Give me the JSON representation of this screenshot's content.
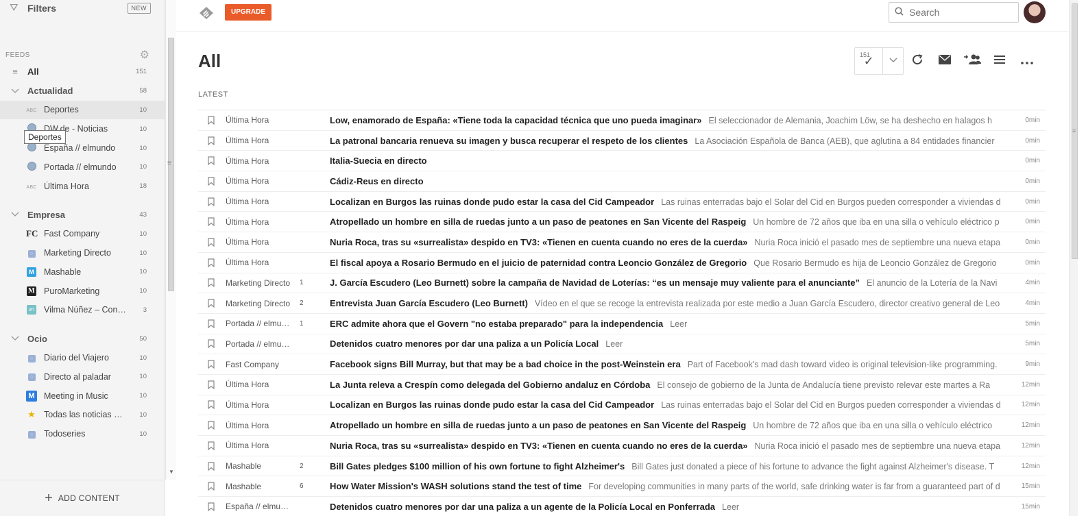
{
  "sidebar": {
    "filters_label": "Filters",
    "new_badge": "NEW",
    "feeds_header": "FEEDS",
    "tooltip": "Deportes",
    "add_content": "ADD CONTENT",
    "items": [
      {
        "kind": "top",
        "icon": "list-icon",
        "name": "All",
        "count": "151"
      },
      {
        "kind": "cat",
        "icon": "chevron-down-icon",
        "name": "Actualidad",
        "count": "58"
      },
      {
        "kind": "sub",
        "icon": "abc-icon",
        "name": "Deportes",
        "count": "10",
        "selected": true
      },
      {
        "kind": "sub",
        "icon": "globe-icon",
        "name": "DW.de - Noticias",
        "count": "10"
      },
      {
        "kind": "sub",
        "icon": "globe-icon",
        "name": "España // elmundo",
        "count": "10"
      },
      {
        "kind": "sub",
        "icon": "globe-icon",
        "name": "Portada // elmundo",
        "count": "10"
      },
      {
        "kind": "sub",
        "icon": "abc-icon",
        "name": "Última Hora",
        "count": "18"
      },
      {
        "kind": "gap"
      },
      {
        "kind": "cat",
        "icon": "chevron-down-icon",
        "name": "Empresa",
        "count": "43"
      },
      {
        "kind": "sub",
        "icon": "fc-icon",
        "name": "Fast Company",
        "count": "10"
      },
      {
        "kind": "sub",
        "icon": "rss-icon",
        "name": "Marketing Directo",
        "count": "10"
      },
      {
        "kind": "sub",
        "icon": "mashable-icon",
        "name": "Mashable",
        "count": "10"
      },
      {
        "kind": "sub",
        "icon": "puromarketing-icon",
        "name": "PuroMarketing",
        "count": "10"
      },
      {
        "kind": "sub",
        "icon": "vilma-icon",
        "name": "Vilma Núñez – Con…",
        "count": "3"
      },
      {
        "kind": "gap"
      },
      {
        "kind": "cat",
        "icon": "chevron-down-icon",
        "name": "Ocio",
        "count": "50"
      },
      {
        "kind": "sub",
        "icon": "rss-icon",
        "name": "Diario del Viajero",
        "count": "10"
      },
      {
        "kind": "sub",
        "icon": "rss-icon",
        "name": "Directo al paladar",
        "count": "10"
      },
      {
        "kind": "sub",
        "icon": "meeting-icon",
        "name": "Meeting in Music",
        "count": "10"
      },
      {
        "kind": "sub",
        "icon": "star-icon",
        "name": "Todas las noticias …",
        "count": "10"
      },
      {
        "kind": "sub",
        "icon": "rss-icon",
        "name": "Todoseries",
        "count": "10"
      }
    ]
  },
  "topbar": {
    "upgrade_label": "UPGRADE",
    "search_placeholder": "Search"
  },
  "main": {
    "title": "All",
    "mark_read_count": "151",
    "section_label": "LATEST",
    "entries": [
      {
        "source": "Última Hora",
        "engagement": "",
        "title": "Low, enamorado de España: «Tiene toda la capacidad técnica que uno pueda imaginar»",
        "summary": "El seleccionador de Alemania, Joachim Löw, se ha deshecho en halagos h",
        "age": "0min"
      },
      {
        "source": "Última Hora",
        "engagement": "",
        "title": "La patronal bancaria renueva su imagen y busca recuperar el respeto de los clientes",
        "summary": "La Asociación Española de Banca (AEB), que aglutina a 84 entidades financier",
        "age": "0min"
      },
      {
        "source": "Última Hora",
        "engagement": "",
        "title": "Italia-Suecia en directo",
        "summary": "",
        "age": "0min"
      },
      {
        "source": "Última Hora",
        "engagement": "",
        "title": "Cádiz-Reus en directo",
        "summary": "",
        "age": "0min"
      },
      {
        "source": "Última Hora",
        "engagement": "",
        "title": "Localizan en Burgos las ruinas donde pudo estar la casa del Cid Campeador",
        "summary": "Las ruinas enterradas bajo el Solar del Cid en Burgos pueden corresponder a viviendas d",
        "age": "0min"
      },
      {
        "source": "Última Hora",
        "engagement": "",
        "title": "Atropellado un hombre en silla de ruedas junto a un paso de peatones en San Vicente del Raspeig",
        "summary": "Un hombre de 72 años que iba en una silla o vehículo eléctrico p",
        "age": "0min"
      },
      {
        "source": "Última Hora",
        "engagement": "",
        "title": "Nuria Roca, tras su «surrealista» despido en TV3: «Tienen en cuenta cuando no eres de la cuerda»",
        "summary": "Nuria Roca inició el pasado mes de septiembre una nueva etapa",
        "age": "0min"
      },
      {
        "source": "Última Hora",
        "engagement": "",
        "title": "El fiscal apoya a Rosario Bermudo en el juicio de paternidad contra Leoncio González de Gregorio",
        "summary": "Que Rosario Bermudo es hija de Leoncio González de Gregorio",
        "age": "0min"
      },
      {
        "source": "Marketing Directo",
        "engagement": "1",
        "title": "J. García Escudero (Leo Burnett) sobre la campaña de Navidad de Loterías: “es un mensaje muy valiente para el anunciante”",
        "summary": "El anuncio de la Lotería de la Navi",
        "age": "4min"
      },
      {
        "source": "Marketing Directo",
        "engagement": "2",
        "title": "Entrevista Juan García Escudero (Leo Burnett)",
        "summary": "Vídeo en el que se recoge la entrevista realizada por este medio a Juan García Escudero, director creativo general de Leo",
        "age": "4min"
      },
      {
        "source": "Portada // elmu…",
        "engagement": "1",
        "title": "ERC admite ahora que el Govern \"no estaba preparado\" para la independencia",
        "summary": "Leer",
        "age": "5min"
      },
      {
        "source": "Portada // elmu…",
        "engagement": "",
        "title": "Detenidos cuatro menores por dar una paliza a un Policía Local",
        "summary": "Leer",
        "age": "5min"
      },
      {
        "source": "Fast Company",
        "engagement": "",
        "title": "Facebook signs Bill Murray, but that may be a bad choice in the post-Weinstein era",
        "summary": "Part of Facebook's mad dash toward video is original television-like programming.",
        "age": "9min"
      },
      {
        "source": "Última Hora",
        "engagement": "",
        "title": "La Junta releva a Crespín como delegada del Gobierno andaluz en Córdoba",
        "summary": "El consejo de gobierno de la Junta de Andalucía tiene previsto relevar este martes a Ra",
        "age": "12min"
      },
      {
        "source": "Última Hora",
        "engagement": "",
        "title": "Localizan en Burgos las ruinas donde pudo estar la casa del Cid Campeador",
        "summary": "Las ruinas enterradas bajo el Solar del Cid en Burgos pueden corresponder a viviendas d",
        "age": "12min"
      },
      {
        "source": "Última Hora",
        "engagement": "",
        "title": "Atropellado un hombre en silla de ruedas junto a un paso de peatones en San Vicente del Raspeig",
        "summary": "Un hombre de 72 años que iba en una silla o vehículo eléctrico",
        "age": "12min"
      },
      {
        "source": "Última Hora",
        "engagement": "",
        "title": "Nuria Roca, tras su «surrealista» despido en TV3: «Tienen en cuenta cuando no eres de la cuerda»",
        "summary": "Nuria Roca inició el pasado mes de septiembre una nueva etapa",
        "age": "12min"
      },
      {
        "source": "Mashable",
        "engagement": "2",
        "title": "Bill Gates pledges $100 million of his own fortune to fight Alzheimer's",
        "summary": "Bill Gates just donated a piece of his fortune to advance the fight against Alzheimer's disease. T",
        "age": "12min"
      },
      {
        "source": "Mashable",
        "engagement": "6",
        "title": "How Water Mission's WASH solutions stand the test of time",
        "summary": "For developing communities in many parts of the world, safe drinking water is far from a guaranteed part of d",
        "age": "15min"
      },
      {
        "source": "España // elmu…",
        "engagement": "",
        "title": "Detenidos cuatro menores por dar una paliza a un agente de la Policía Local en Ponferrada",
        "summary": "Leer",
        "age": "15min"
      }
    ]
  },
  "colors": {
    "accent": "#ea5b2a",
    "sidebar_bg": "#f4f4f4",
    "selected_bg": "#e6e6e6"
  }
}
